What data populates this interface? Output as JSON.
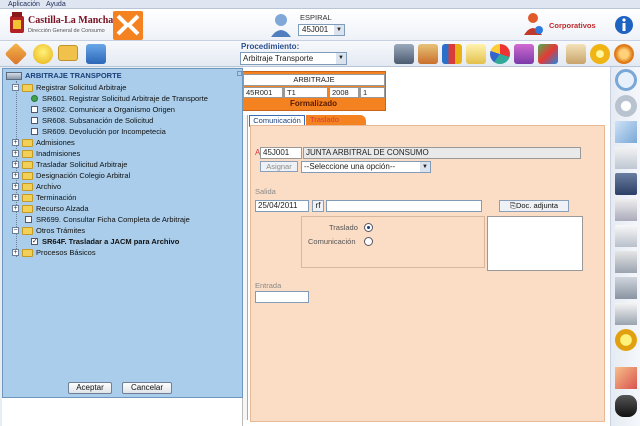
{
  "menu": {
    "items": [
      "Aplicación",
      "Ayuda"
    ]
  },
  "header": {
    "logo_title": "Castilla-La Mancha",
    "logo_subtitle": "Dirección General de Consumo",
    "user_name": "ESPIRAL",
    "user_code": "45J001",
    "corporate_label": "Corporativos"
  },
  "toolbar": {
    "procedure_label": "Procedimiento:",
    "procedure_value": "Arbitraje Transporte"
  },
  "record": {
    "title": "ARBITRAJE",
    "fields": [
      "45R001",
      "T1",
      "2008",
      "1"
    ],
    "status": "Formalizado"
  },
  "tabs": [
    {
      "label": "Comunicación",
      "active": true
    },
    {
      "label": "Traslado",
      "active": false
    }
  ],
  "form": {
    "marker": "A",
    "org_code": "45J001",
    "org_name": "JUNTA ARBITRAL DE CONSUMO",
    "assign_label": "Asignar",
    "option_select": "--Seleccione una opción--",
    "salida_label": "Salida",
    "salida_date": "25/04/2011",
    "rf_label": "rf",
    "doc_button": "Doc. adjunta",
    "traslado_label": "Traslado",
    "comunicacion_label": "Comunicación",
    "entrada_label": "Entrada"
  },
  "tree": {
    "root": "ARBITRAJE TRANSPORTE",
    "nodes": [
      {
        "label": "Registrar Solicitud Arbitraje",
        "type": "folder",
        "expanded": true
      },
      {
        "label": "SR601. Registrar Solicitud Arbitraje de Transporte",
        "type": "task"
      },
      {
        "label": "SR602. Comunicar a Organismo Origen",
        "type": "task"
      },
      {
        "label": "SR608. Subsanación de Solicitud",
        "type": "task"
      },
      {
        "label": "SR609. Devolución por Incompetecia",
        "type": "task"
      },
      {
        "label": "Admisiones",
        "type": "folder"
      },
      {
        "label": "Inadmisiones",
        "type": "folder"
      },
      {
        "label": "Trasladar Solicitud Arbitraje",
        "type": "folder"
      },
      {
        "label": "Designación Colegio Arbitral",
        "type": "folder"
      },
      {
        "label": "Archivo",
        "type": "folder"
      },
      {
        "label": "Terminación",
        "type": "folder"
      },
      {
        "label": "Recurso Alzada",
        "type": "folder"
      },
      {
        "label": "SR699. Consultar Ficha Completa de Arbitraje",
        "type": "task"
      },
      {
        "label": "Otros Trámites",
        "type": "folder",
        "expanded": true
      },
      {
        "label": "SR64F. Trasladar a JACM para Archivo",
        "type": "task",
        "checked": true
      },
      {
        "label": "Procesos Básicos",
        "type": "folder"
      }
    ],
    "accept_button": "Aceptar",
    "cancel_button": "Cancelar"
  },
  "icons": {
    "toolbar_left": [
      "ruler-icon",
      "lightbulb-icon",
      "folder-icon",
      "database-icon"
    ],
    "toolbar_right": [
      "laptop-icon",
      "person-search-icon",
      "books-icon",
      "card-icon",
      "pie-chart-icon",
      "stamp-icon",
      "puzzle-icon",
      "scroll-icon",
      "gear-icon",
      "star-icon"
    ],
    "sidebar_right": [
      "search-icon",
      "back-icon",
      "document-icon",
      "folders-icon",
      "save-icon",
      "delete-icon",
      "print-icon",
      "clip-icon",
      "stack-icon",
      "printer-icon",
      "sun-icon",
      "cancel-icon",
      "binoculars-icon"
    ]
  },
  "colors": {
    "accent": "#f58220",
    "tree_bg": "#a9cdea",
    "form_bg": "#fbdcc4",
    "tab_active": "#3a6db2"
  }
}
